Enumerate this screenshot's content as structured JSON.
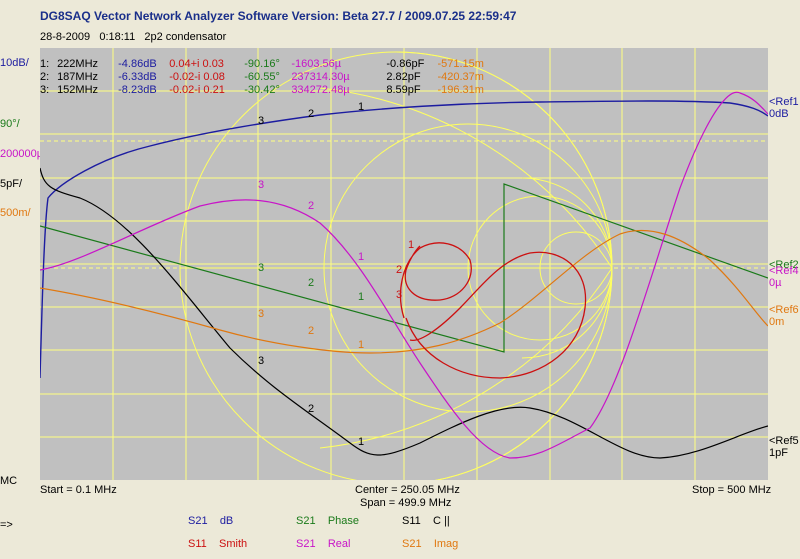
{
  "window": {
    "title": "DG8SAQ Vector Network Analyzer Software   Version:  Beta 27.7 / 2009.07.25 22:59:47",
    "date": "28-8-2009",
    "time": "0:18:11",
    "description": "2p2 condensator"
  },
  "markers": [
    {
      "id": "1:",
      "freq": "222MHz",
      "db": "-4.86dB",
      "smith": "0.04+i 0.03",
      "phase": "-90.16°",
      "real": "-1603.56µ",
      "c": "-0.86pF",
      "imag": "-571.15m"
    },
    {
      "id": "2:",
      "freq": "187MHz",
      "db": "-6.33dB",
      "smith": "-0.02-i 0.08",
      "phase": "-60.55°",
      "real": "237314.30µ",
      "c": "2.82pF",
      "imag": "-420.37m"
    },
    {
      "id": "3:",
      "freq": "152MHz",
      "db": "-8.23dB",
      "smith": "-0.02-i 0.21",
      "phase": "-30.42°",
      "real": "334272.48µ",
      "c": "8.59pF",
      "imag": "-196.31m"
    }
  ],
  "left_scale": {
    "db": "10dB/",
    "phase": "90°/",
    "real": "200000µ/",
    "cap": "5pF/",
    "imag": "500m/",
    "mc": "MC",
    "arrow": "=>"
  },
  "right_refs": {
    "ref1": "<Ref1",
    "ref1_val": "0dB",
    "ref2": "<Ref2",
    "ref4": "<Ref4",
    "ref4_val": "0µ",
    "ref6": "<Ref6",
    "ref6_val": "0m",
    "ref5": "<Ref5",
    "ref5_val": "1pF"
  },
  "axis": {
    "start": "Start = 0.1 MHz",
    "center": "Center = 250.05 MHz",
    "span": "Span = 499.9 MHz",
    "stop": "Stop = 500 MHz"
  },
  "legend": [
    {
      "param": "S21",
      "format": "dB",
      "color": "#1c1ca0"
    },
    {
      "param": "S21",
      "format": "Phase",
      "color": "#1a7a1a"
    },
    {
      "param": "S11",
      "format": "C ||",
      "color": "#000000"
    },
    {
      "param": "S11",
      "format": "Smith",
      "color": "#cc1010"
    },
    {
      "param": "S21",
      "format": "Real",
      "color": "#c814c8"
    },
    {
      "param": "S21",
      "format": "Imag",
      "color": "#e07810"
    }
  ],
  "marker_labels": [
    "1",
    "2",
    "3"
  ],
  "colors": {
    "db": "#1c1ca0",
    "phase": "#1a7a1a",
    "cap": "#000000",
    "smith": "#cc1010",
    "real": "#c814c8",
    "imag": "#e07810",
    "grid": "#ffff80",
    "plot_bg": "#c0c0c0",
    "window_bg": "#ece9d8"
  }
}
